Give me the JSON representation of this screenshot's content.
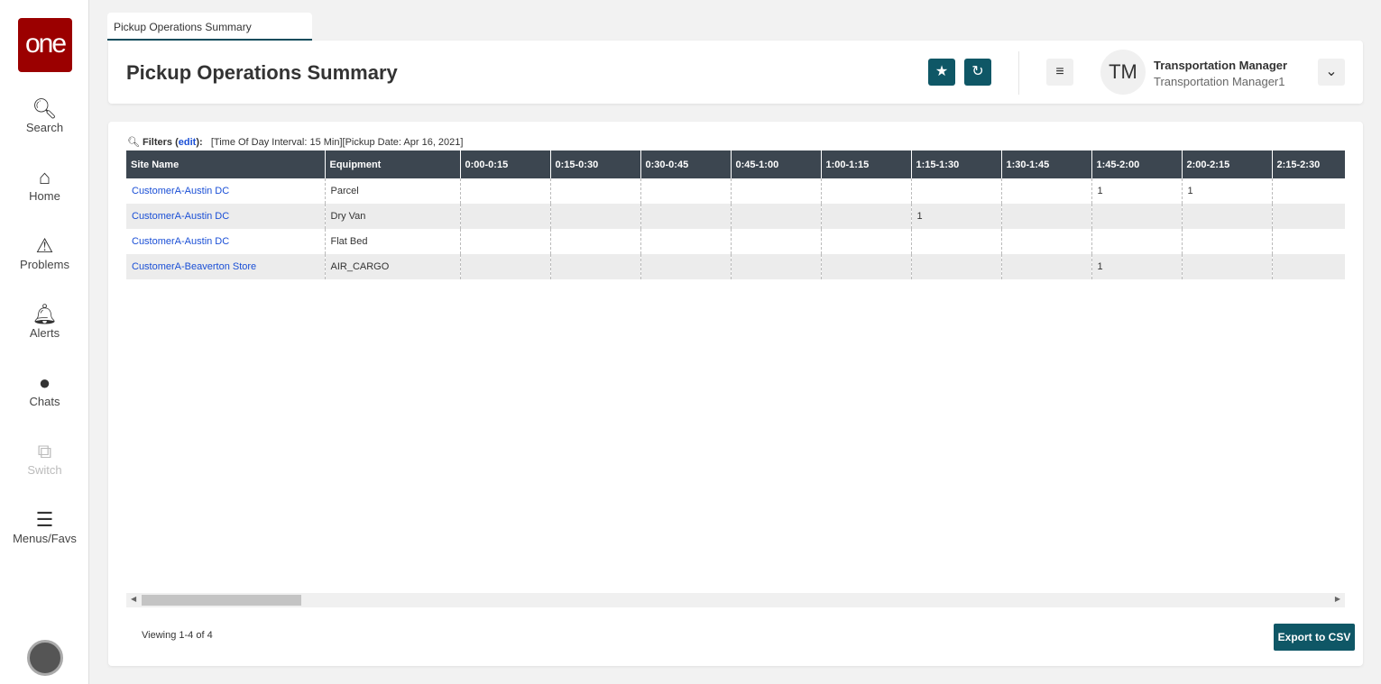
{
  "sidebar": {
    "logo": "one",
    "items": [
      {
        "label": "Search",
        "icon": "search-icon"
      },
      {
        "label": "Home",
        "icon": "home-icon"
      },
      {
        "label": "Problems",
        "icon": "warning-icon"
      },
      {
        "label": "Alerts",
        "icon": "bell-icon"
      },
      {
        "label": "Chats",
        "icon": "chat-icon"
      },
      {
        "label": "Switch",
        "icon": "switch-icon"
      },
      {
        "label": "Menus/Favs",
        "icon": "menu-icon"
      }
    ]
  },
  "tab": {
    "label": "Pickup Operations Summary"
  },
  "header": {
    "title": "Pickup Operations Summary",
    "user_initials": "TM",
    "user_name": "Transportation Manager",
    "user_role": "Transportation Manager1"
  },
  "filters": {
    "label": "Filters",
    "edit": "edit",
    "value": "[Time Of Day Interval: 15 Min][Pickup Date: Apr 16, 2021]"
  },
  "table": {
    "columns": [
      "Site Name",
      "Equipment",
      "0:00-0:15",
      "0:15-0:30",
      "0:30-0:45",
      "0:45-1:00",
      "1:00-1:15",
      "1:15-1:30",
      "1:30-1:45",
      "1:45-2:00",
      "2:00-2:15",
      "2:15-2:30"
    ],
    "rows": [
      [
        "CustomerA-Austin DC",
        "Parcel",
        "",
        "",
        "",
        "",
        "",
        "",
        "",
        "1",
        "1",
        ""
      ],
      [
        "CustomerA-Austin DC",
        "Dry Van",
        "",
        "",
        "",
        "",
        "",
        "1",
        "",
        "",
        "",
        ""
      ],
      [
        "CustomerA-Austin DC",
        "Flat Bed",
        "",
        "",
        "",
        "",
        "",
        "",
        "",
        "",
        "",
        ""
      ],
      [
        "CustomerA-Beaverton Store",
        "AIR_CARGO",
        "",
        "",
        "",
        "",
        "",
        "",
        "",
        "1",
        "",
        ""
      ]
    ]
  },
  "footer": {
    "viewing": "Viewing 1-4 of 4",
    "export": "Export to CSV"
  }
}
